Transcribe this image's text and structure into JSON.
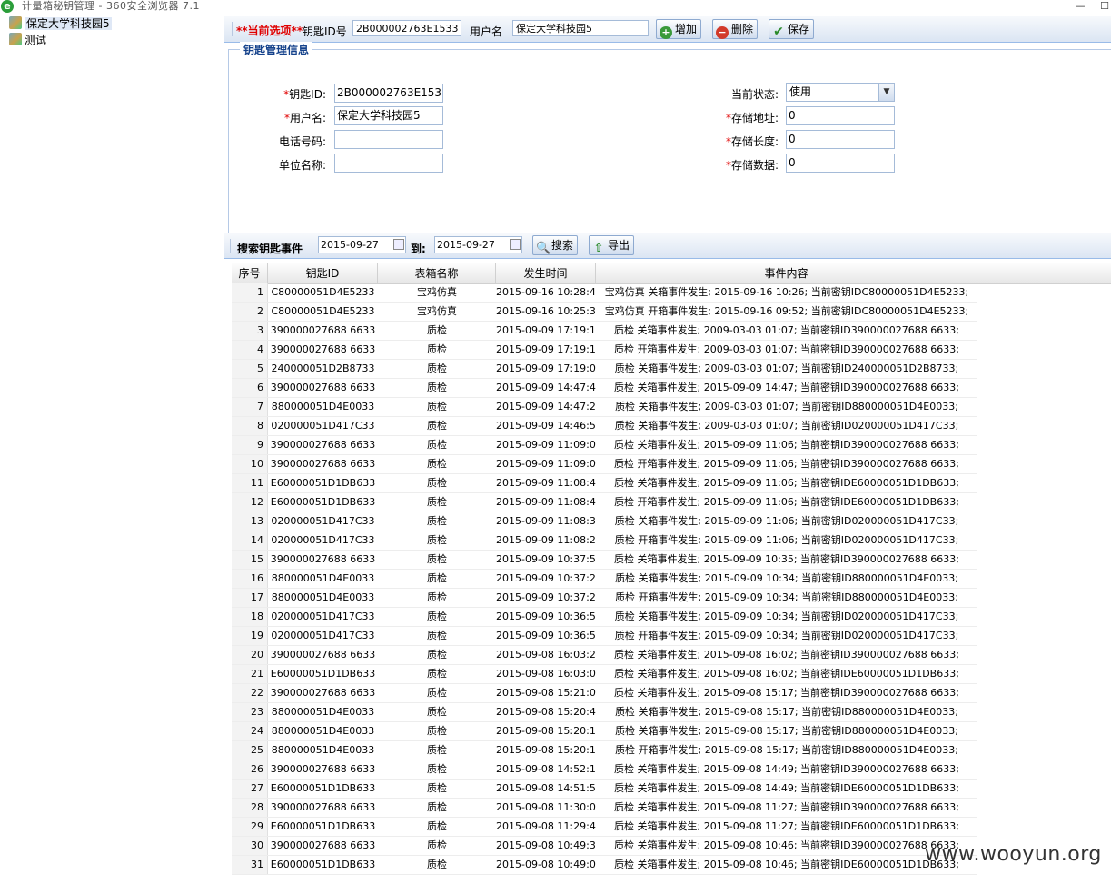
{
  "window": {
    "title": "计量箱秘钥管理 - 360安全浏览器 7.1",
    "browser_icon": "e-browser-icon"
  },
  "tree": {
    "items": [
      {
        "label": "保定大学科技园5",
        "selected": true
      },
      {
        "label": "测试",
        "selected": false
      }
    ]
  },
  "toolbar": {
    "current_label": "**当前选项**",
    "key_id_label": "钥匙ID号",
    "key_id_value": "2B000002763E1533",
    "username_label": "用户名",
    "username_value": "保定大学科技园5",
    "add_label": "增加",
    "delete_label": "删除",
    "save_label": "保存"
  },
  "form": {
    "legend": "钥匙管理信息",
    "key_id_label": "钥匙ID:",
    "key_id_value": "2B000002763E1533",
    "username_label": "用户名:",
    "username_value": "保定大学科技园5",
    "phone_label": "电话号码:",
    "phone_value": "",
    "unit_label": "单位名称:",
    "unit_value": "",
    "status_label": "当前状态:",
    "status_value": "使用",
    "addr_label": "存储地址:",
    "addr_value": "0",
    "len_label": "存储长度:",
    "len_value": "0",
    "data_label": "存储数据:",
    "data_value": "0",
    "required_mark": "*"
  },
  "search": {
    "label": "搜索钥匙事件",
    "from": "2015-09-27",
    "to_label": "到:",
    "to": "2015-09-27",
    "search_label": "搜索",
    "export_label": "导出"
  },
  "grid": {
    "headers": [
      "序号",
      "钥匙ID",
      "表箱名称",
      "发生时间",
      "事件内容"
    ],
    "rows": [
      [
        "1",
        "C80000051D4E5233",
        "宝鸡仿真",
        "2015-09-16 10:28:40",
        "宝鸡仿真 关箱事件发生; 2015-09-16 10:26; 当前密钥IDC80000051D4E5233;"
      ],
      [
        "2",
        "C80000051D4E5233",
        "宝鸡仿真",
        "2015-09-16 10:25:39",
        "宝鸡仿真 开箱事件发生; 2015-09-16 09:52; 当前密钥IDC80000051D4E5233;"
      ],
      [
        "3",
        "390000027688 6633",
        "质检",
        "2015-09-09 17:19:13",
        "质检 关箱事件发生; 2009-03-03 01:07; 当前密钥ID390000027688 6633;"
      ],
      [
        "4",
        "390000027688 6633",
        "质检",
        "2015-09-09 17:19:10",
        "质检 开箱事件发生; 2009-03-03 01:07; 当前密钥ID390000027688 6633;"
      ],
      [
        "5",
        "240000051D2B8733",
        "质检",
        "2015-09-09 17:19:02",
        "质检 关箱事件发生; 2009-03-03 01:07; 当前密钥ID240000051D2B8733;"
      ],
      [
        "6",
        "390000027688 6633",
        "质检",
        "2015-09-09 14:47:44",
        "质检 关箱事件发生; 2015-09-09 14:47; 当前密钥ID390000027688 6633;"
      ],
      [
        "7",
        "880000051D4E0033",
        "质检",
        "2015-09-09 14:47:20",
        "质检 关箱事件发生; 2009-03-03 01:07; 当前密钥ID880000051D4E0033;"
      ],
      [
        "8",
        "020000051D417C33",
        "质检",
        "2015-09-09 14:46:58",
        "质检 关箱事件发生; 2009-03-03 01:07; 当前密钥ID020000051D417C33;"
      ],
      [
        "9",
        "390000027688 6633",
        "质检",
        "2015-09-09 11:09:08",
        "质检 关箱事件发生; 2015-09-09 11:06; 当前密钥ID390000027688 6633;"
      ],
      [
        "10",
        "390000027688 6633",
        "质检",
        "2015-09-09 11:09:07",
        "质检 开箱事件发生; 2015-09-09 11:06; 当前密钥ID390000027688 6633;"
      ],
      [
        "11",
        "E60000051D1DB633",
        "质检",
        "2015-09-09 11:08:42",
        "质检 关箱事件发生; 2015-09-09 11:06; 当前密钥IDE60000051D1DB633;"
      ],
      [
        "12",
        "E60000051D1DB633",
        "质检",
        "2015-09-09 11:08:40",
        "质检 开箱事件发生; 2015-09-09 11:06; 当前密钥IDE60000051D1DB633;"
      ],
      [
        "13",
        "020000051D417C33",
        "质检",
        "2015-09-09 11:08:32",
        "质检 关箱事件发生; 2015-09-09 11:06; 当前密钥ID020000051D417C33;"
      ],
      [
        "14",
        "020000051D417C33",
        "质检",
        "2015-09-09 11:08:29",
        "质检 开箱事件发生; 2015-09-09 11:06; 当前密钥ID020000051D417C33;"
      ],
      [
        "15",
        "390000027688 6633",
        "质检",
        "2015-09-09 10:37:51",
        "质检 关箱事件发生; 2015-09-09 10:35; 当前密钥ID390000027688 6633;"
      ],
      [
        "16",
        "880000051D4E0033",
        "质检",
        "2015-09-09 10:37:25",
        "质检 关箱事件发生; 2015-09-09 10:34; 当前密钥ID880000051D4E0033;"
      ],
      [
        "17",
        "880000051D4E0033",
        "质检",
        "2015-09-09 10:37:23",
        "质检 开箱事件发生; 2015-09-09 10:34; 当前密钥ID880000051D4E0033;"
      ],
      [
        "18",
        "020000051D417C33",
        "质检",
        "2015-09-09 10:36:58",
        "质检 关箱事件发生; 2015-09-09 10:34; 当前密钥ID020000051D417C33;"
      ],
      [
        "19",
        "020000051D417C33",
        "质检",
        "2015-09-09 10:36:55",
        "质检 开箱事件发生; 2015-09-09 10:34; 当前密钥ID020000051D417C33;"
      ],
      [
        "20",
        "390000027688 6633",
        "质检",
        "2015-09-08 16:03:28",
        "质检 关箱事件发生; 2015-09-08 16:02; 当前密钥ID390000027688 6633;"
      ],
      [
        "21",
        "E60000051D1DB633",
        "质检",
        "2015-09-08 16:03:04",
        "质检 关箱事件发生; 2015-09-08 16:02; 当前密钥IDE60000051D1DB633;"
      ],
      [
        "22",
        "390000027688 6633",
        "质检",
        "2015-09-08 15:21:09",
        "质检 关箱事件发生; 2015-09-08 15:17; 当前密钥ID390000027688 6633;"
      ],
      [
        "23",
        "880000051D4E0033",
        "质检",
        "2015-09-08 15:20:44",
        "质检 关箱事件发生; 2015-09-08 15:17; 当前密钥ID880000051D4E0033;"
      ],
      [
        "24",
        "880000051D4E0033",
        "质检",
        "2015-09-08 15:20:19",
        "质检 关箱事件发生; 2015-09-08 15:17; 当前密钥ID880000051D4E0033;"
      ],
      [
        "25",
        "880000051D4E0033",
        "质检",
        "2015-09-08 15:20:16",
        "质检 开箱事件发生; 2015-09-08 15:17; 当前密钥ID880000051D4E0033;"
      ],
      [
        "26",
        "390000027688 6633",
        "质检",
        "2015-09-08 14:52:18",
        "质检 关箱事件发生; 2015-09-08 14:49; 当前密钥ID390000027688 6633;"
      ],
      [
        "27",
        "E60000051D1DB633",
        "质检",
        "2015-09-08 14:51:56",
        "质检 关箱事件发生; 2015-09-08 14:49; 当前密钥IDE60000051D1DB633;"
      ],
      [
        "28",
        "390000027688 6633",
        "质检",
        "2015-09-08 11:30:08",
        "质检 关箱事件发生; 2015-09-08 11:27; 当前密钥ID390000027688 6633;"
      ],
      [
        "29",
        "E60000051D1DB633",
        "质检",
        "2015-09-08 11:29:41",
        "质检 关箱事件发生; 2015-09-08 11:27; 当前密钥IDE60000051D1DB633;"
      ],
      [
        "30",
        "390000027688 6633",
        "质检",
        "2015-09-08 10:49:34",
        "质检 关箱事件发生; 2015-09-08 10:46; 当前密钥ID390000027688 6633;"
      ],
      [
        "31",
        "E60000051D1DB633",
        "质检",
        "2015-09-08 10:49:09",
        "质检 关箱事件发生; 2015-09-08 10:46; 当前密钥IDE60000051D1DB633;"
      ]
    ]
  },
  "watermark": "www.wooyun.org"
}
